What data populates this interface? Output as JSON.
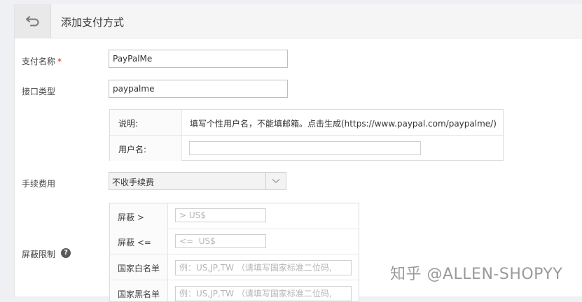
{
  "header": {
    "title": "添加支付方式",
    "back_icon": "undo-arrow-icon"
  },
  "form": {
    "payment_name": {
      "label": "支付名称",
      "required_mark": "*",
      "value": "PayPalMe"
    },
    "interface_type": {
      "label": "接口类型",
      "value": "paypalme"
    },
    "config_box": {
      "description_label": "说明:",
      "description_text": "填写个性用户名，不能填邮箱。点击生成(https://www.paypal.com/paypalme/)",
      "username_label": "用户名:",
      "username_value": ""
    },
    "fee": {
      "label": "手续费用",
      "selected": "不收手续费",
      "caret_icon": "chevron-down-icon"
    },
    "block_limit": {
      "label": "屏蔽限制",
      "help_icon": "question-circle-icon",
      "help_glyph": "?",
      "rows": [
        {
          "label": "屏蔽 >",
          "placeholder": "> US$"
        },
        {
          "label": "屏蔽 <=",
          "placeholder": "<=  US$"
        },
        {
          "label": "国家白名单",
          "placeholder": "例：US,JP,TW （请填写国家标准二位码,"
        },
        {
          "label": "国家黑名单",
          "placeholder": "例：US,JP,TW （请填写国家标准二位码,"
        }
      ]
    }
  },
  "watermark": "知乎 @ALLEN-SHOPYY"
}
